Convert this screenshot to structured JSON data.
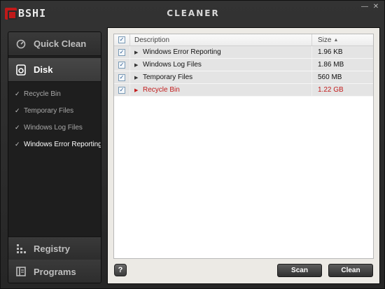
{
  "app": {
    "logo_text": "BSHI",
    "title": "CLEANER",
    "window_controls": [
      "minimize-icon",
      "close-icon"
    ]
  },
  "sidebar": {
    "nav": [
      {
        "label": "Quick Clean",
        "icon": "quick-clean-icon",
        "active": false
      },
      {
        "label": "Disk",
        "icon": "disk-icon",
        "active": true
      },
      {
        "label": "Registry",
        "icon": "registry-icon",
        "active": false
      },
      {
        "label": "Programs",
        "icon": "programs-icon",
        "active": false
      }
    ],
    "disk_items": [
      {
        "label": "Recycle Bin",
        "checked": true,
        "selected": false
      },
      {
        "label": "Temporary Files",
        "checked": true,
        "selected": false
      },
      {
        "label": "Windows Log Files",
        "checked": true,
        "selected": false
      },
      {
        "label": "Windows Error Reporting",
        "checked": true,
        "selected": true
      }
    ]
  },
  "table": {
    "columns": {
      "description": "Description",
      "size": "Size"
    },
    "rows": [
      {
        "description": "Windows Error Reporting",
        "size": "1.96 KB",
        "checked": true,
        "highlight": false
      },
      {
        "description": "Windows Log Files",
        "size": "1.86 MB",
        "checked": true,
        "highlight": false
      },
      {
        "description": "Temporary Files",
        "size": "560 MB",
        "checked": true,
        "highlight": false
      },
      {
        "description": "Recycle Bin",
        "size": "1.22 GB",
        "checked": true,
        "highlight": true
      }
    ]
  },
  "actions": {
    "help": "?",
    "scan": "Scan",
    "clean": "Clean"
  },
  "colors": {
    "brand_red": "#c01a1a",
    "highlight_text": "#c21d1d"
  }
}
